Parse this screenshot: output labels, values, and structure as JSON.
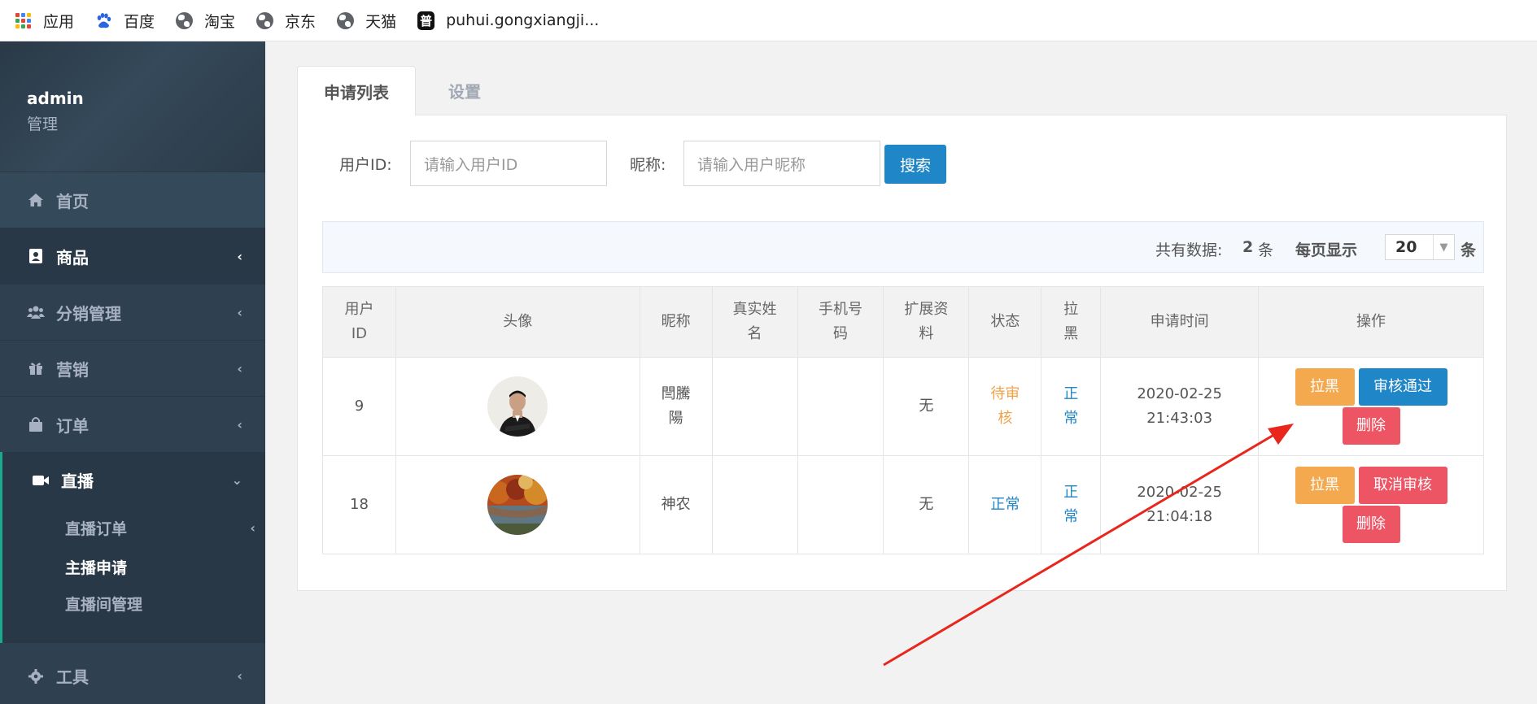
{
  "bookmarks": [
    {
      "label": "应用",
      "icon": "apps-grid-icon"
    },
    {
      "label": "百度",
      "icon": "baidu-paw-icon"
    },
    {
      "label": "淘宝",
      "icon": "globe-icon"
    },
    {
      "label": "京东",
      "icon": "globe-icon"
    },
    {
      "label": "天猫",
      "icon": "globe-icon"
    },
    {
      "label": "puhui.gongxiangji...",
      "icon": "pu-logo-icon",
      "icon_text": "普"
    }
  ],
  "sidebar": {
    "user": "admin",
    "role": "管理",
    "items": [
      {
        "label": "首页",
        "icon": "home-icon"
      },
      {
        "label": "商品",
        "icon": "goods-icon"
      },
      {
        "label": "分销管理",
        "icon": "users-icon"
      },
      {
        "label": "营销",
        "icon": "gift-icon"
      },
      {
        "label": "订单",
        "icon": "shopping-bag-icon"
      },
      {
        "label": "直播",
        "icon": "video-camera-icon"
      },
      {
        "label": "工具",
        "icon": "gear-icon"
      }
    ],
    "live_sub": [
      {
        "label": "直播订单"
      },
      {
        "label": "主播申请"
      },
      {
        "label": "直播间管理"
      }
    ]
  },
  "tabs": [
    {
      "label": "申请列表"
    },
    {
      "label": "设置"
    }
  ],
  "search": {
    "user_id_label": "用户ID:",
    "user_id_placeholder": "请输入用户ID",
    "nickname_label": "昵称:",
    "nickname_placeholder": "请输入用户昵称",
    "button": "搜索"
  },
  "summary": {
    "total_label": "共有数据:",
    "total": "2",
    "unit": "条",
    "per_page_label": "每页显示",
    "per_page": "20",
    "per_page_unit": "条"
  },
  "table": {
    "headers": [
      "用户ID",
      "头像",
      "昵称",
      "真实姓名",
      "手机号码",
      "扩展资料",
      "状态",
      "拉黑",
      "申请时间",
      "操作"
    ],
    "rows": [
      {
        "user_id": "9",
        "nickname": "閆騰陽",
        "real_name": "",
        "phone": "",
        "ext": "无",
        "status": "待审核",
        "status_color": "#f0a24b",
        "blacklist": "正常",
        "date": "2020-02-25",
        "time": "21:43:03",
        "actions": [
          "拉黑",
          "审核通过",
          "删除"
        ]
      },
      {
        "user_id": "18",
        "nickname": "神农",
        "real_name": "",
        "phone": "",
        "ext": "无",
        "status": "正常",
        "status_color": "#1f86c8",
        "blacklist": "正常",
        "date": "2020-02-25",
        "time": "21:04:18",
        "actions": [
          "拉黑",
          "取消审核",
          "删除"
        ]
      }
    ]
  },
  "colors": {
    "sidebar_bg": "#2f4050",
    "accent_green": "#19aa8d",
    "primary_blue": "#1f86c8",
    "warning_orange": "#f5a94e",
    "danger_red": "#ed5565",
    "annotation_arrow": "#e8261b"
  }
}
